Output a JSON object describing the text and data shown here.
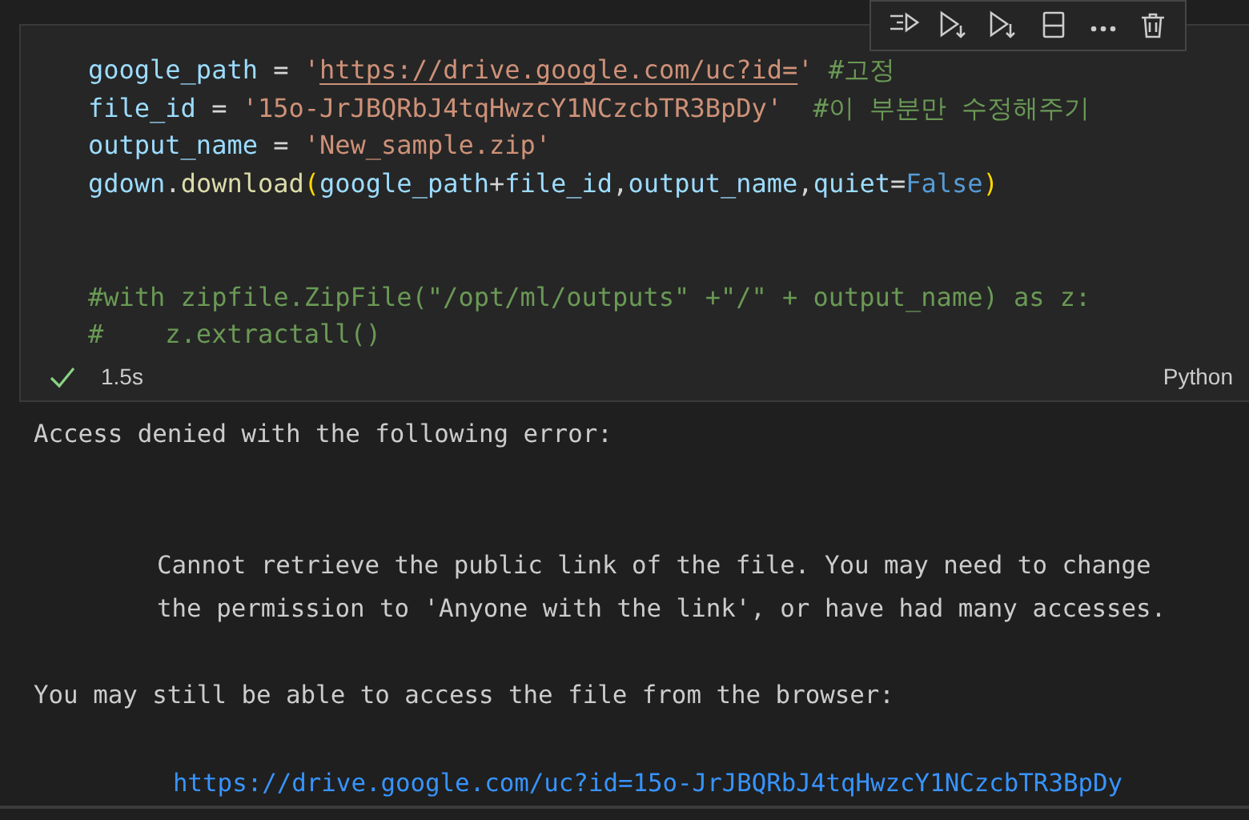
{
  "toolbar": {
    "items": [
      {
        "kind": "run-above"
      },
      {
        "kind": "run-below"
      },
      {
        "kind": "run-next"
      },
      {
        "kind": "split"
      },
      {
        "kind": "more"
      },
      {
        "kind": "delete"
      }
    ]
  },
  "cell": {
    "code": [
      {
        "kind": "code",
        "tokens": [
          {
            "kind": "var",
            "text": "google_path"
          },
          {
            "kind": "op",
            "text": " = "
          },
          {
            "kind": "str",
            "text": "'"
          },
          {
            "kind": "url",
            "text": "https://drive.google.com/uc?id="
          },
          {
            "kind": "str",
            "text": "' "
          },
          {
            "kind": "comment",
            "text": "#고정"
          }
        ]
      },
      {
        "kind": "code",
        "tokens": [
          {
            "kind": "var",
            "text": "file_id"
          },
          {
            "kind": "op",
            "text": " = "
          },
          {
            "kind": "str",
            "text": "'15o-JrJBQRbJ4tqHwzcY1NCzcbTR3BpDy'  "
          },
          {
            "kind": "comment",
            "text": "#이 부분만 수정해주기"
          }
        ]
      },
      {
        "kind": "code",
        "tokens": [
          {
            "kind": "var",
            "text": "output_name"
          },
          {
            "kind": "op",
            "text": " = "
          },
          {
            "kind": "str",
            "text": "'New_sample.zip'"
          }
        ]
      },
      {
        "kind": "code",
        "tokens": [
          {
            "kind": "var",
            "text": "gdown"
          },
          {
            "kind": "op",
            "text": "."
          },
          {
            "kind": "func",
            "text": "download"
          },
          {
            "kind": "paren",
            "text": "("
          },
          {
            "kind": "var",
            "text": "google_path"
          },
          {
            "kind": "op",
            "text": "+"
          },
          {
            "kind": "var",
            "text": "file_id"
          },
          {
            "kind": "op",
            "text": ","
          },
          {
            "kind": "var",
            "text": "output_name"
          },
          {
            "kind": "op",
            "text": ","
          },
          {
            "kind": "var",
            "text": "quiet"
          },
          {
            "kind": "op",
            "text": "="
          },
          {
            "kind": "kw",
            "text": "False"
          },
          {
            "kind": "paren",
            "text": ")"
          }
        ]
      },
      {
        "kind": "blank"
      },
      {
        "kind": "blank"
      },
      {
        "kind": "code",
        "tokens": [
          {
            "kind": "comment",
            "text": "#with zipfile.ZipFile(\"/opt/ml/outputs\" +\"/\" + output_name) as z:"
          }
        ]
      },
      {
        "kind": "code",
        "tokens": [
          {
            "kind": "comment",
            "text": "#    z.extractall()"
          }
        ]
      }
    ],
    "succeeded": true,
    "duration": "1.5s",
    "language": "Python"
  },
  "output": [
    {
      "kind": "text",
      "text": "Access denied with the following error:"
    },
    {
      "kind": "blank"
    },
    {
      "kind": "blank"
    },
    {
      "kind": "indented",
      "text": "Cannot retrieve the public link of the file. You may need to change"
    },
    {
      "kind": "indented",
      "text": "the permission to 'Anyone with the link', or have had many accesses."
    },
    {
      "kind": "blank"
    },
    {
      "kind": "text",
      "text": "You may still be able to access the file from the browser:"
    },
    {
      "kind": "blank"
    },
    {
      "kind": "link",
      "text": "https://drive.google.com/uc?id=15o-JrJBQRbJ4tqHwzcY1NCzcbTR3BpDy"
    }
  ]
}
